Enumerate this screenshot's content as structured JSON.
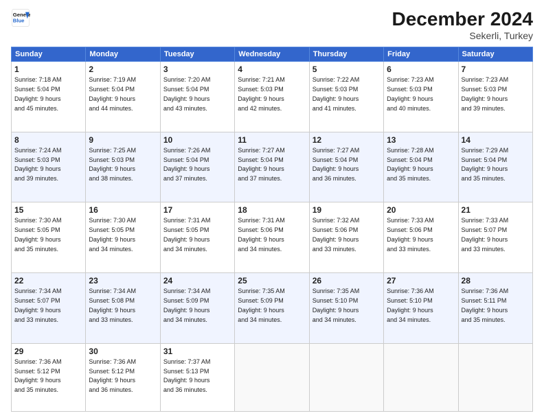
{
  "header": {
    "logo_line1": "General",
    "logo_line2": "Blue",
    "month": "December 2024",
    "location": "Sekerli, Turkey"
  },
  "weekdays": [
    "Sunday",
    "Monday",
    "Tuesday",
    "Wednesday",
    "Thursday",
    "Friday",
    "Saturday"
  ],
  "weeks": [
    [
      {
        "day": "1",
        "info": "Sunrise: 7:18 AM\nSunset: 5:04 PM\nDaylight: 9 hours\nand 45 minutes."
      },
      {
        "day": "2",
        "info": "Sunrise: 7:19 AM\nSunset: 5:04 PM\nDaylight: 9 hours\nand 44 minutes."
      },
      {
        "day": "3",
        "info": "Sunrise: 7:20 AM\nSunset: 5:04 PM\nDaylight: 9 hours\nand 43 minutes."
      },
      {
        "day": "4",
        "info": "Sunrise: 7:21 AM\nSunset: 5:03 PM\nDaylight: 9 hours\nand 42 minutes."
      },
      {
        "day": "5",
        "info": "Sunrise: 7:22 AM\nSunset: 5:03 PM\nDaylight: 9 hours\nand 41 minutes."
      },
      {
        "day": "6",
        "info": "Sunrise: 7:23 AM\nSunset: 5:03 PM\nDaylight: 9 hours\nand 40 minutes."
      },
      {
        "day": "7",
        "info": "Sunrise: 7:23 AM\nSunset: 5:03 PM\nDaylight: 9 hours\nand 39 minutes."
      }
    ],
    [
      {
        "day": "8",
        "info": "Sunrise: 7:24 AM\nSunset: 5:03 PM\nDaylight: 9 hours\nand 39 minutes."
      },
      {
        "day": "9",
        "info": "Sunrise: 7:25 AM\nSunset: 5:03 PM\nDaylight: 9 hours\nand 38 minutes."
      },
      {
        "day": "10",
        "info": "Sunrise: 7:26 AM\nSunset: 5:04 PM\nDaylight: 9 hours\nand 37 minutes."
      },
      {
        "day": "11",
        "info": "Sunrise: 7:27 AM\nSunset: 5:04 PM\nDaylight: 9 hours\nand 37 minutes."
      },
      {
        "day": "12",
        "info": "Sunrise: 7:27 AM\nSunset: 5:04 PM\nDaylight: 9 hours\nand 36 minutes."
      },
      {
        "day": "13",
        "info": "Sunrise: 7:28 AM\nSunset: 5:04 PM\nDaylight: 9 hours\nand 35 minutes."
      },
      {
        "day": "14",
        "info": "Sunrise: 7:29 AM\nSunset: 5:04 PM\nDaylight: 9 hours\nand 35 minutes."
      }
    ],
    [
      {
        "day": "15",
        "info": "Sunrise: 7:30 AM\nSunset: 5:05 PM\nDaylight: 9 hours\nand 35 minutes."
      },
      {
        "day": "16",
        "info": "Sunrise: 7:30 AM\nSunset: 5:05 PM\nDaylight: 9 hours\nand 34 minutes."
      },
      {
        "day": "17",
        "info": "Sunrise: 7:31 AM\nSunset: 5:05 PM\nDaylight: 9 hours\nand 34 minutes."
      },
      {
        "day": "18",
        "info": "Sunrise: 7:31 AM\nSunset: 5:06 PM\nDaylight: 9 hours\nand 34 minutes."
      },
      {
        "day": "19",
        "info": "Sunrise: 7:32 AM\nSunset: 5:06 PM\nDaylight: 9 hours\nand 33 minutes."
      },
      {
        "day": "20",
        "info": "Sunrise: 7:33 AM\nSunset: 5:06 PM\nDaylight: 9 hours\nand 33 minutes."
      },
      {
        "day": "21",
        "info": "Sunrise: 7:33 AM\nSunset: 5:07 PM\nDaylight: 9 hours\nand 33 minutes."
      }
    ],
    [
      {
        "day": "22",
        "info": "Sunrise: 7:34 AM\nSunset: 5:07 PM\nDaylight: 9 hours\nand 33 minutes."
      },
      {
        "day": "23",
        "info": "Sunrise: 7:34 AM\nSunset: 5:08 PM\nDaylight: 9 hours\nand 33 minutes."
      },
      {
        "day": "24",
        "info": "Sunrise: 7:34 AM\nSunset: 5:09 PM\nDaylight: 9 hours\nand 34 minutes."
      },
      {
        "day": "25",
        "info": "Sunrise: 7:35 AM\nSunset: 5:09 PM\nDaylight: 9 hours\nand 34 minutes."
      },
      {
        "day": "26",
        "info": "Sunrise: 7:35 AM\nSunset: 5:10 PM\nDaylight: 9 hours\nand 34 minutes."
      },
      {
        "day": "27",
        "info": "Sunrise: 7:36 AM\nSunset: 5:10 PM\nDaylight: 9 hours\nand 34 minutes."
      },
      {
        "day": "28",
        "info": "Sunrise: 7:36 AM\nSunset: 5:11 PM\nDaylight: 9 hours\nand 35 minutes."
      }
    ],
    [
      {
        "day": "29",
        "info": "Sunrise: 7:36 AM\nSunset: 5:12 PM\nDaylight: 9 hours\nand 35 minutes."
      },
      {
        "day": "30",
        "info": "Sunrise: 7:36 AM\nSunset: 5:12 PM\nDaylight: 9 hours\nand 36 minutes."
      },
      {
        "day": "31",
        "info": "Sunrise: 7:37 AM\nSunset: 5:13 PM\nDaylight: 9 hours\nand 36 minutes."
      },
      null,
      null,
      null,
      null
    ]
  ]
}
